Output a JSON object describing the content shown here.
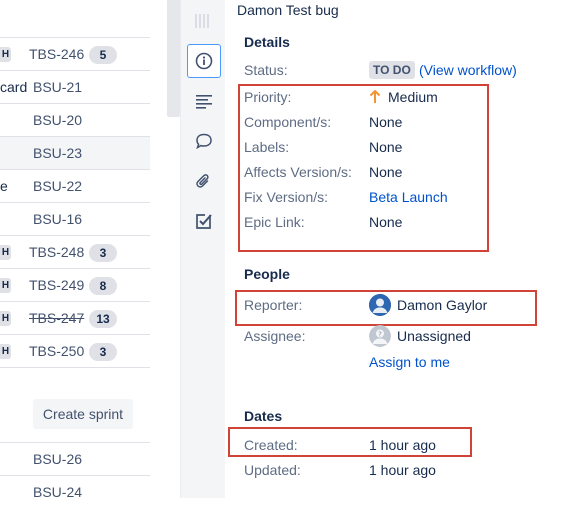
{
  "backlog": {
    "rows": [
      {
        "partial_label": "",
        "tag": "H",
        "key": "TBS-246",
        "badge": "5",
        "selected": false,
        "strike": false
      },
      {
        "partial_label": "card",
        "tag": "",
        "key": "BSU-21",
        "badge": "",
        "selected": false,
        "strike": false
      },
      {
        "partial_label": "",
        "tag": "",
        "key": "BSU-20",
        "badge": "",
        "selected": false,
        "strike": false
      },
      {
        "partial_label": "",
        "tag": "",
        "key": "BSU-23",
        "badge": "",
        "selected": true,
        "strike": false
      },
      {
        "partial_label": "e",
        "tag": "",
        "key": "BSU-22",
        "badge": "",
        "selected": false,
        "strike": false
      },
      {
        "partial_label": "",
        "tag": "",
        "key": "BSU-16",
        "badge": "",
        "selected": false,
        "strike": false
      },
      {
        "partial_label": "",
        "tag": "H",
        "key": "TBS-248",
        "badge": "3",
        "selected": false,
        "strike": false
      },
      {
        "partial_label": "",
        "tag": "H",
        "key": "TBS-249",
        "badge": "8",
        "selected": false,
        "strike": false
      },
      {
        "partial_label": "",
        "tag": "H",
        "key": "TBS-247",
        "badge": "13",
        "selected": false,
        "strike": true
      },
      {
        "partial_label": "",
        "tag": "H",
        "key": "TBS-250",
        "badge": "3",
        "selected": false,
        "strike": false
      }
    ],
    "create_sprint_label": "Create sprint",
    "lower_rows": [
      {
        "key": "BSU-26"
      },
      {
        "key": "BSU-24"
      }
    ]
  },
  "rail": {
    "icons": [
      "grip-icon",
      "info-icon",
      "description-icon",
      "comment-icon",
      "attachment-icon",
      "checklist-icon"
    ],
    "active": "info-icon"
  },
  "issue": {
    "title": "Damon Test bug",
    "details_heading": "Details",
    "status_label": "Status:",
    "status_value": "TO DO",
    "view_workflow": "(View workflow)",
    "priority_label": "Priority:",
    "priority_value": "Medium",
    "component_label": "Component/s:",
    "component_value": "None",
    "labels_label": "Labels:",
    "labels_value": "None",
    "affects_label": "Affects Version/s:",
    "affects_value": "None",
    "fix_label": "Fix Version/s:",
    "fix_value": "Beta Launch",
    "epic_label": "Epic Link:",
    "epic_value": "None",
    "people_heading": "People",
    "reporter_label": "Reporter:",
    "reporter_value": "Damon Gaylor",
    "assignee_label": "Assignee:",
    "assignee_value": "Unassigned",
    "assign_to_me": "Assign to me",
    "dates_heading": "Dates",
    "created_label": "Created:",
    "created_value": "1 hour ago",
    "updated_label": "Updated:",
    "updated_value": "1 hour ago"
  },
  "colors": {
    "highlight": "#d04437",
    "link": "#0052cc",
    "priority_medium": "#f79232",
    "active_rail_border": "#4c9aff"
  }
}
